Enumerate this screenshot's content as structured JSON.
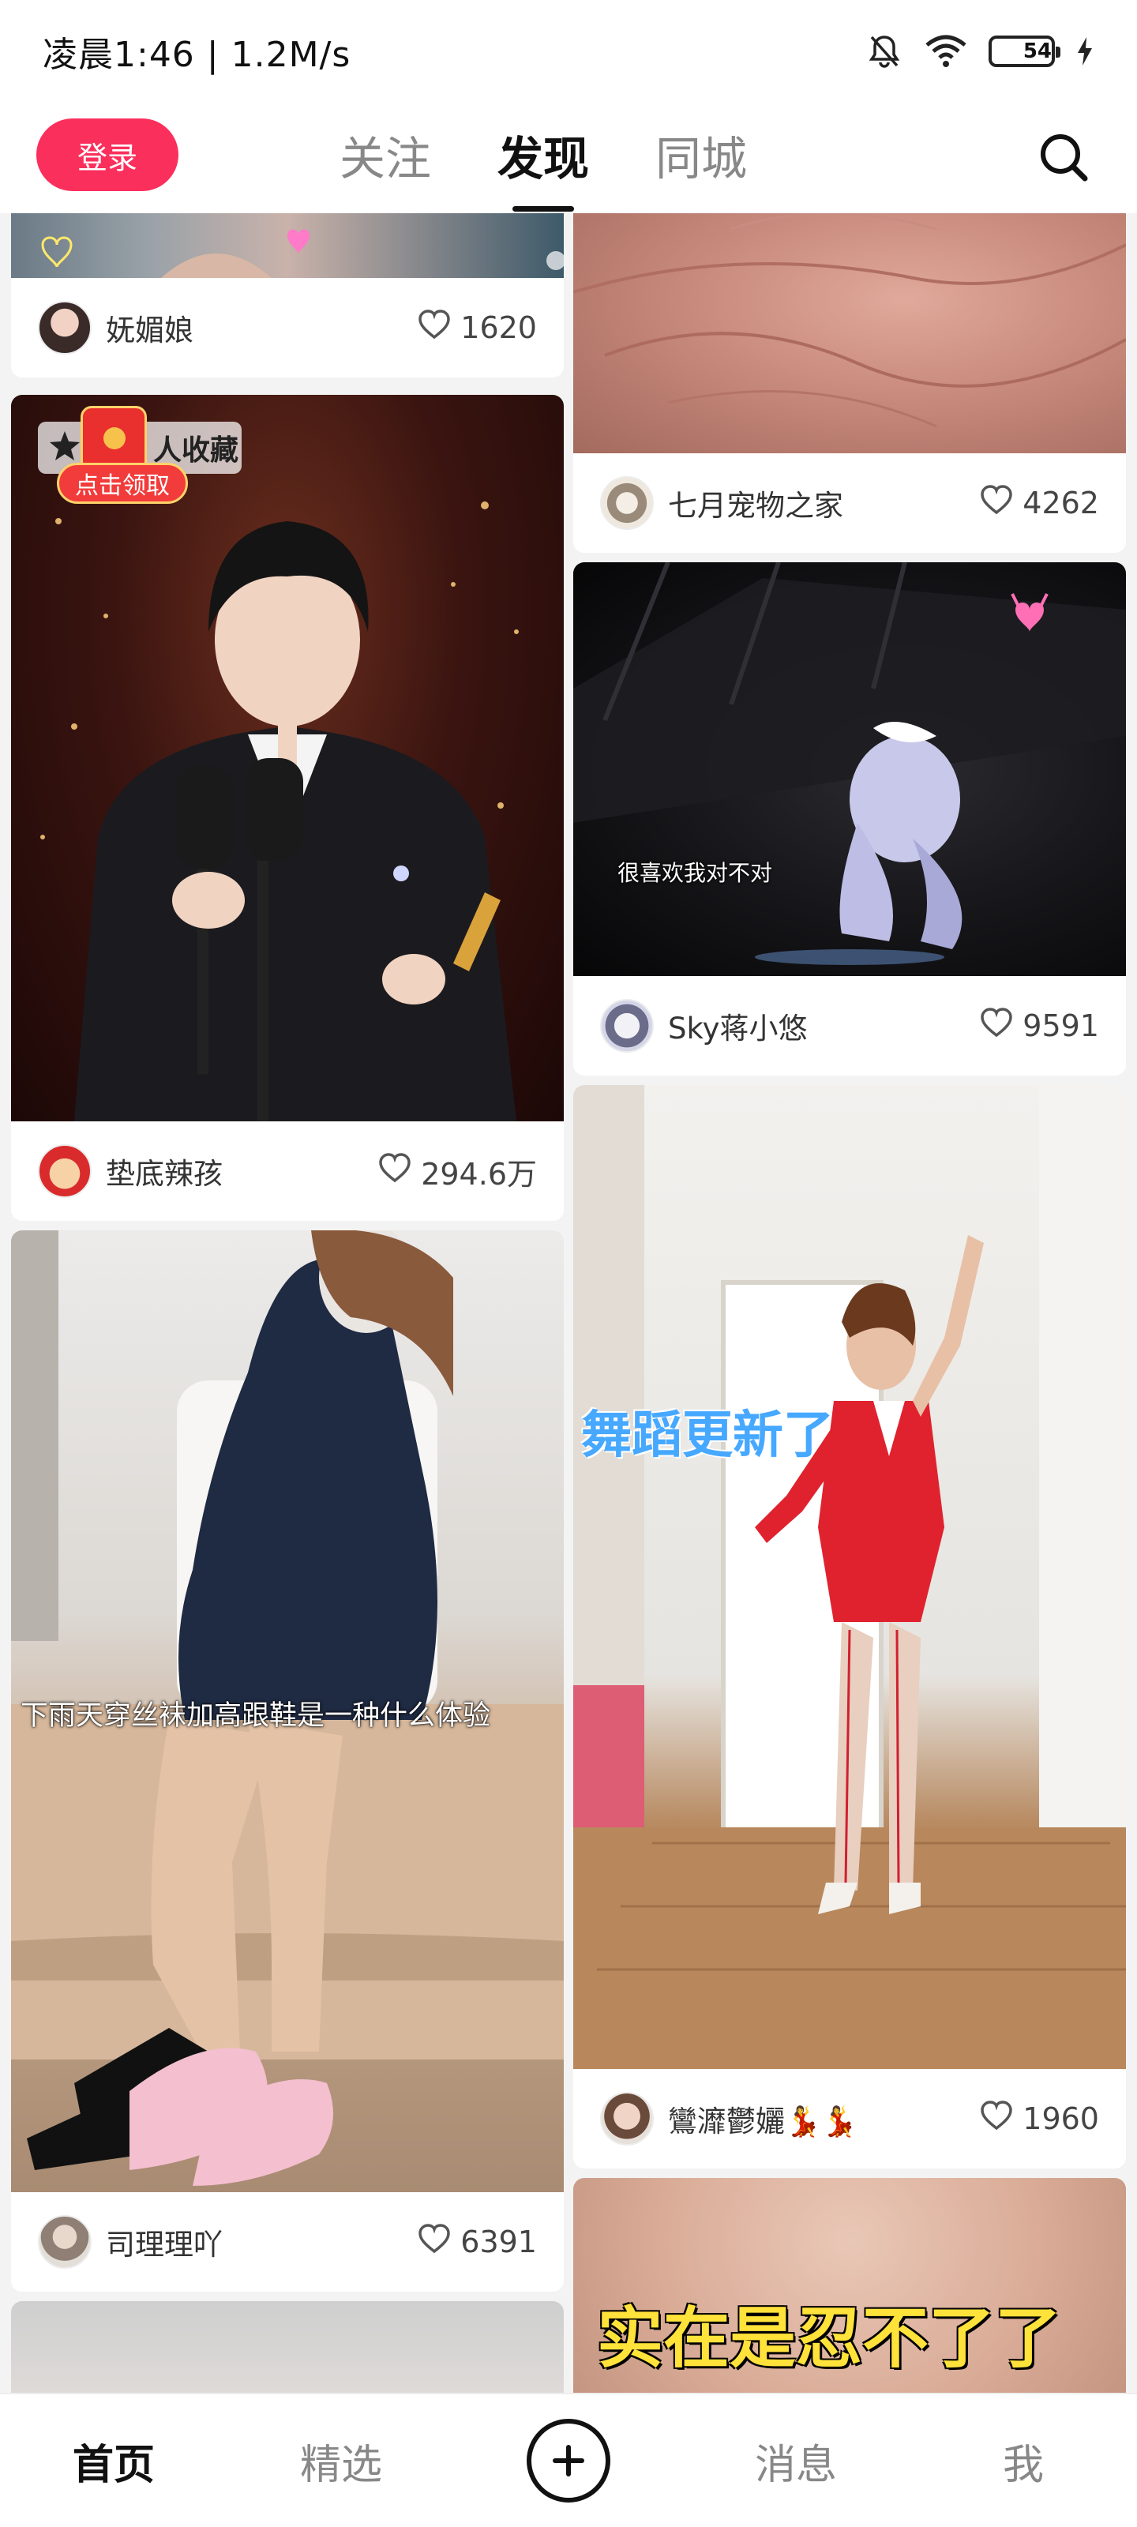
{
  "status_bar": {
    "time_speed": "凌晨1:46 | 1.2M/s",
    "battery": "54",
    "icons": [
      "mute-bell-icon",
      "wifi-icon",
      "battery-icon",
      "charging-bolt-icon"
    ]
  },
  "header": {
    "login_label": "登录",
    "tabs": [
      {
        "label": "关注",
        "active": false
      },
      {
        "label": "发现",
        "active": true
      },
      {
        "label": "同城",
        "active": false
      }
    ],
    "search_icon": "search-icon"
  },
  "feed": {
    "left": [
      {
        "author": "妩媚娘",
        "likes": "1620"
      },
      {
        "author": "垫底辣孩",
        "likes": "294.6万",
        "badge_text": "人收藏",
        "claim_text": "点击领取"
      },
      {
        "author": "司理理吖",
        "likes": "6391",
        "caption": "下雨天穿丝袜加高跟鞋是一种什么体验"
      }
    ],
    "right": [
      {
        "author": "七月宠物之家",
        "likes": "4262"
      },
      {
        "author": "Sky蒋小悠",
        "likes": "9591",
        "caption": "很喜欢我对不对"
      },
      {
        "author": "鸞灖鬱孋💃💃",
        "likes": "1960",
        "caption": "舞蹈更新了"
      },
      {
        "caption": "实在是忍不了了"
      }
    ]
  },
  "bottom_nav": {
    "items": [
      {
        "label": "首页",
        "active": true
      },
      {
        "label": "精选",
        "active": false
      },
      {
        "label": "消息",
        "active": false
      },
      {
        "label": "我",
        "active": false
      }
    ],
    "add_icon": "plus-circle-icon"
  },
  "colors": {
    "accent": "#fb2f5c",
    "background": "#f3f3f3",
    "card": "#ffffff"
  }
}
